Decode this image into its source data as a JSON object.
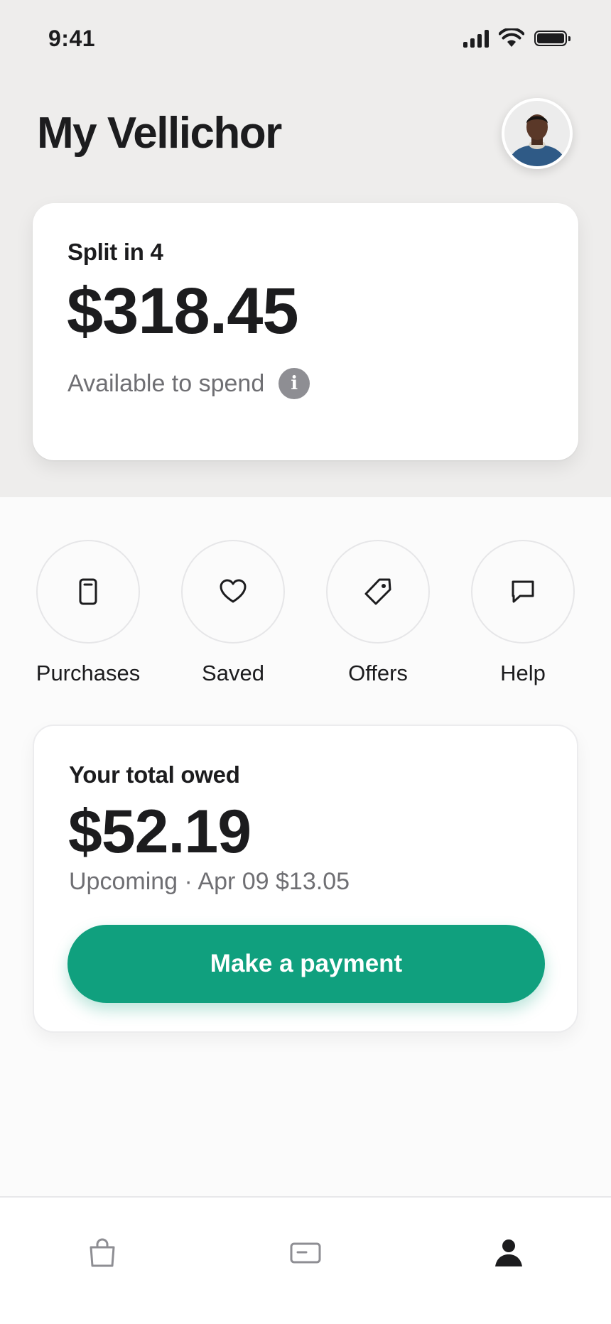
{
  "status_bar": {
    "time": "9:41",
    "icons": [
      "cellular-signal-icon",
      "wifi-icon",
      "battery-icon"
    ]
  },
  "header": {
    "title": "My Vellichor",
    "avatar_icon": "profile-photo"
  },
  "balance_card": {
    "label": "Split in 4",
    "amount": "$318.45",
    "subtitle": "Available to spend",
    "info_icon": "i"
  },
  "quick_actions": [
    {
      "label": "Purchases",
      "icon": "receipt-icon"
    },
    {
      "label": "Saved",
      "icon": "heart-icon"
    },
    {
      "label": "Offers",
      "icon": "tag-icon"
    },
    {
      "label": "Help",
      "icon": "chat-bubble-icon"
    }
  ],
  "owed_card": {
    "label": "Your total owed",
    "amount": "$52.19",
    "upcoming": "Upcoming · Apr 09 $13.05",
    "button_label": "Make a payment"
  },
  "tab_bar": {
    "items": [
      {
        "icon": "shopping-bag-icon",
        "active": false
      },
      {
        "icon": "card-icon",
        "active": false
      },
      {
        "icon": "person-icon",
        "active": true
      }
    ]
  },
  "colors": {
    "accent": "#10a07e",
    "header_background": "#eeedec",
    "page_background": "#fbfbfb",
    "primary_text": "#1c1c1e",
    "secondary_text": "#6f6f73"
  }
}
